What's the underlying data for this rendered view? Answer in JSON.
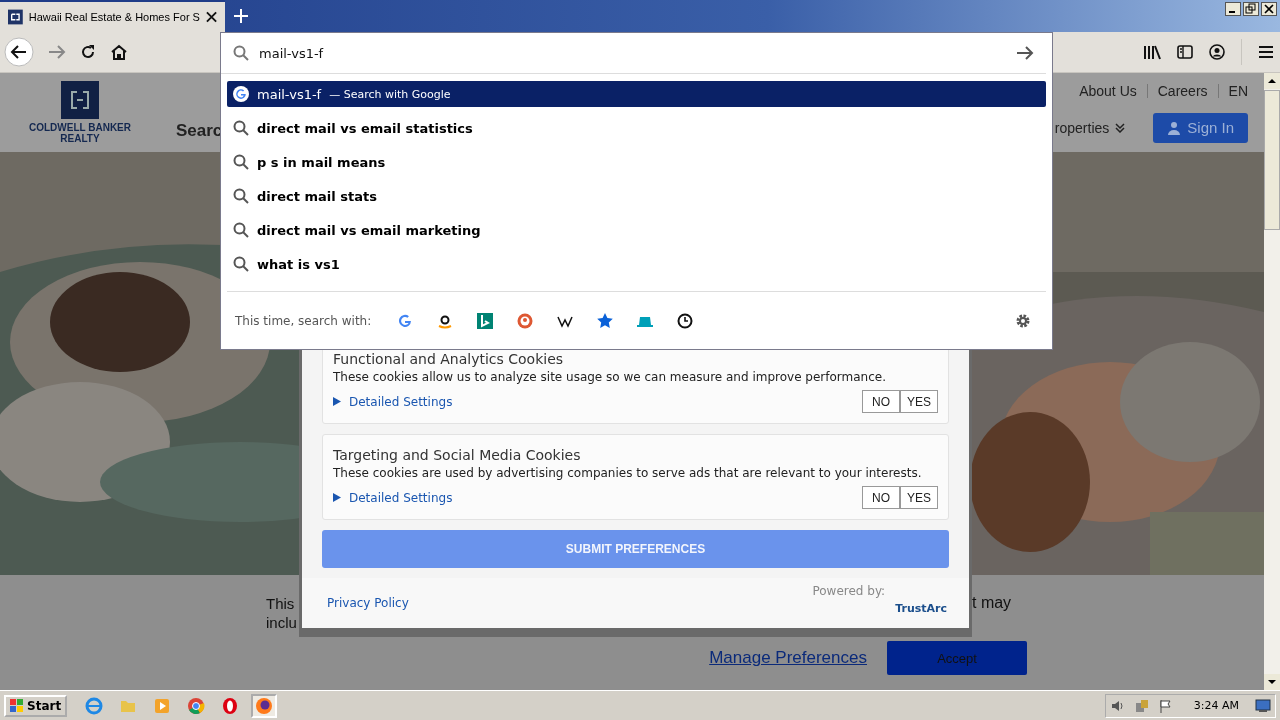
{
  "browser": {
    "tab": {
      "title": "Hawaii Real Estate & Homes For S",
      "selected": true
    },
    "address": {
      "value": "mail-vs1-f"
    },
    "suggestions": [
      {
        "kind": "engine",
        "text": "mail-vs1-f",
        "action": "— Search with Google",
        "selected": true
      },
      {
        "kind": "search",
        "text": "direct mail vs email statistics",
        "selected": false
      },
      {
        "kind": "search",
        "text": "p s in mail means",
        "selected": false
      },
      {
        "kind": "search",
        "text": "direct mail stats",
        "selected": false
      },
      {
        "kind": "search",
        "text": "direct mail vs email marketing",
        "selected": false
      },
      {
        "kind": "search",
        "text": "what is vs1",
        "selected": false
      }
    ],
    "search_with": {
      "label": "This time, search with:"
    }
  },
  "site_header": {
    "logo": {
      "line1": "COLDWELL BANKER",
      "line2": "REALTY"
    },
    "search_partial": "Searc",
    "nav": [
      "About Us",
      "Careers",
      "EN"
    ],
    "properties": "roperties",
    "sign_in": "Sign In"
  },
  "cookie_modal": {
    "categories": [
      {
        "title": "Functional and Analytics Cookies",
        "description": "These cookies allow us to analyze site usage so we can measure and improve performance.",
        "link": "Detailed Settings",
        "no": "NO",
        "yes": "YES"
      },
      {
        "title": "Targeting and Social Media Cookies",
        "description": "These cookies are used by advertising companies to serve ads that are relevant to your interests.",
        "link": "Detailed Settings",
        "no": "NO",
        "yes": "YES"
      }
    ],
    "submit": "SUBMIT PREFERENCES",
    "privacy": "Privacy Policy",
    "powered_by": "Powered by:",
    "brand": "TrustArc"
  },
  "cookie_banner": {
    "left_lines": [
      "This",
      "inclu"
    ],
    "right_text": "t may",
    "manage": "Manage Preferences",
    "accept": "Accept"
  },
  "taskbar": {
    "start": "Start",
    "apps": [
      {
        "kind": "ie",
        "selected": false
      },
      {
        "kind": "folder",
        "selected": false
      },
      {
        "kind": "media",
        "selected": false
      },
      {
        "kind": "chrome",
        "selected": false
      },
      {
        "kind": "opera",
        "selected": false
      },
      {
        "kind": "firefox",
        "selected": true
      }
    ],
    "clock": "3:24 AM"
  }
}
